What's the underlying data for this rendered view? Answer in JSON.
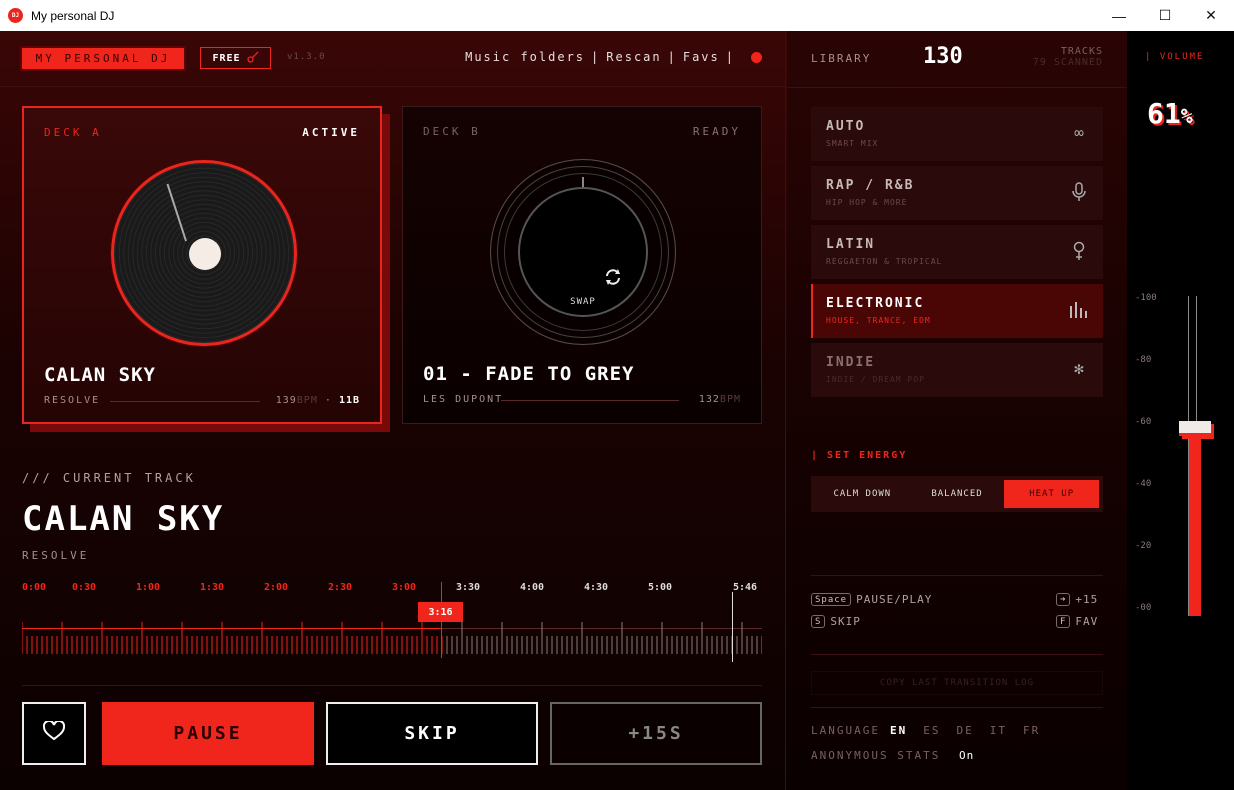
{
  "window": {
    "title": "My personal DJ",
    "logo_text": "DJ",
    "minimize": "—",
    "maximize": "☐",
    "close": "✕"
  },
  "header": {
    "brand": "MY PERSONAL DJ",
    "free_badge": "FREE",
    "version": "v1.3.0",
    "nav": [
      "Music folders",
      "Rescan",
      "Favs"
    ],
    "nav_sep": "|"
  },
  "decks": {
    "a": {
      "label": "DECK A",
      "status": "ACTIVE",
      "title": "CALAN SKY",
      "artist": "RESOLVE",
      "bpm": "139",
      "bpm_unit": "BPM",
      "key_sep": "·",
      "key": "11B"
    },
    "b": {
      "label": "DECK B",
      "status": "READY",
      "title": "01 - FADE TO GREY",
      "artist": "LES DUPONT",
      "bpm": "132",
      "bpm_unit": "BPM",
      "swap_label": "SWAP"
    }
  },
  "current": {
    "label": "/// CURRENT TRACK",
    "title": "CALAN SKY",
    "artist": "RESOLVE",
    "position": "3:16",
    "progress": 0.568,
    "times_past": [
      "0:00",
      "0:30",
      "1:00",
      "1:30",
      "2:00",
      "2:30",
      "3:00"
    ],
    "times_future": [
      "3:30",
      "4:00",
      "4:30",
      "5:00"
    ],
    "duration": "5:46"
  },
  "controls": {
    "fav_icon": "♡",
    "pause": "PAUSE",
    "skip": "SKIP",
    "plus15": "+15S"
  },
  "library": {
    "label": "LIBRARY",
    "count": "130",
    "tracks_label": "TRACKS",
    "scanned": "79 SCANNED",
    "genres": [
      {
        "name": "AUTO",
        "sub": "SMART MIX",
        "icon": "∞"
      },
      {
        "name": "RAP / R&B",
        "sub": "HIP HOP & MORE",
        "icon": "🎙"
      },
      {
        "name": "LATIN",
        "sub": "REGGAETON & TROPICAL",
        "icon": "♀"
      },
      {
        "name": "ELECTRONIC",
        "sub": "HOUSE, TRANCE, EDM",
        "icon": "▮"
      },
      {
        "name": "INDIE",
        "sub": "INDIE / DREAM POP",
        "icon": "✻"
      }
    ]
  },
  "energy": {
    "label": "| SET ENERGY",
    "options": [
      "CALM DOWN",
      "BALANCED",
      "HEAT UP"
    ],
    "selected": "HEAT UP"
  },
  "shortcuts": {
    "space_key": "Space",
    "space_action": "PAUSE/PLAY",
    "arrow_key": "➜",
    "arrow_action": "+15",
    "s_key": "S",
    "s_action": "SKIP",
    "f_key": "F",
    "f_action": "FAV"
  },
  "copy_log": "COPY LAST TRANSITION LOG",
  "settings": {
    "language_label": "LANGUAGE",
    "languages": [
      "EN",
      "ES",
      "DE",
      "IT",
      "FR"
    ],
    "language_selected": "EN",
    "stats_label": "ANONYMOUS STATS",
    "stats_value": "On"
  },
  "volume": {
    "label": "| VOLUME",
    "value": "61",
    "unit": "%",
    "level": 0.61,
    "scale": [
      "-100",
      "-80",
      "-60",
      "-40",
      "-20",
      "-00"
    ]
  },
  "colors": {
    "accent": "#f0251b",
    "background": "#1a0202"
  }
}
